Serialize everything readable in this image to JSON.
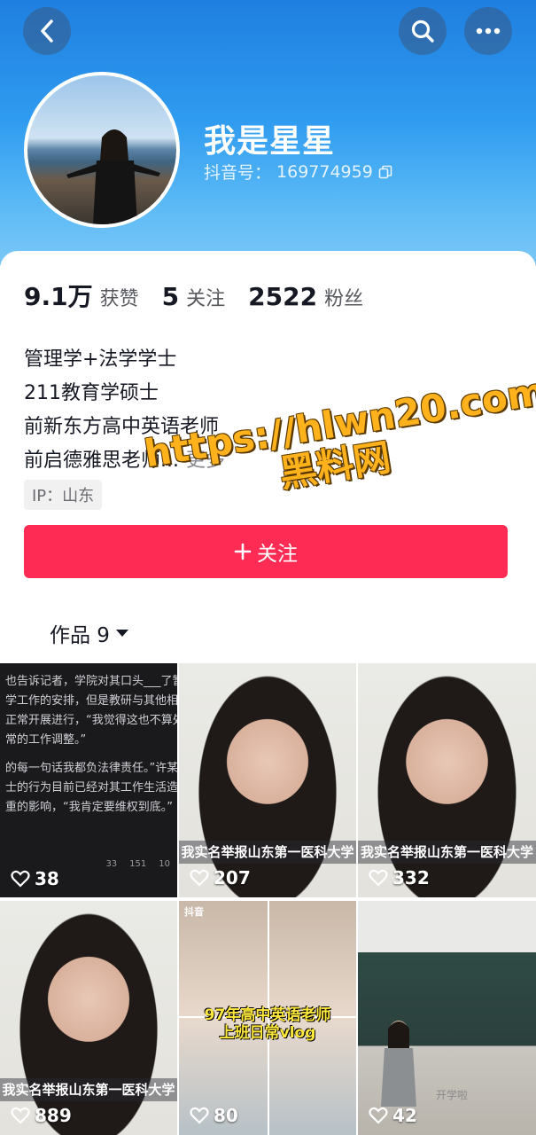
{
  "profile": {
    "name": "我是星星",
    "douyin_id_label": "抖音号：",
    "douyin_id": "169774959"
  },
  "stats": [
    {
      "value": "9.1万",
      "label": "获赞"
    },
    {
      "value": "5",
      "label": "关注"
    },
    {
      "value": "2522",
      "label": "粉丝"
    }
  ],
  "bio": {
    "lines": [
      "管理学+法学学士",
      "211教育学硕士",
      "前新东方高中英语老师",
      "前启德雅思老师..."
    ],
    "more_label": "更多"
  },
  "ip_tag": "IP：山东",
  "follow_button": {
    "label": "关注",
    "icon": "plus-icon"
  },
  "works_tab": {
    "label": "作品 9"
  },
  "videos": [
    {
      "likes": "38",
      "type": "text-post",
      "text_lines": [
        "也告诉记者，学院对其口头___了暂",
        "学工作的安排，但是教研与其他相关",
        "正常开展进行，“我觉得这也不算处理",
        "常的工作调整。”",
        "",
        "的每一句话我都负法律责任。”许某",
        "士的行为目前已经对其工作生活造成",
        "重的影响，“我肯定要维权到底。”"
      ],
      "footer": [
        "33",
        "151",
        "10"
      ]
    },
    {
      "likes": "207",
      "type": "portrait",
      "caption": "我实名举报山东第一医科大学"
    },
    {
      "likes": "332",
      "type": "portrait",
      "caption": "我实名举报山东第一医科大学"
    },
    {
      "likes": "889",
      "type": "portrait",
      "caption": "我实名举报山东第一医科大学"
    },
    {
      "likes": "80",
      "type": "collage",
      "caption_line1": "97年高中英语老师",
      "caption_line2": "上班日常vlog",
      "badge": "抖音"
    },
    {
      "likes": "42",
      "type": "classroom",
      "overlay_text": "开学啦"
    }
  ],
  "watermark": {
    "url": "https://hlwn20.com",
    "site": "黑料网"
  },
  "colors": {
    "accent": "#fe2c55",
    "header_blue": "#2f9bf0",
    "watermark": "#ffb21c"
  }
}
